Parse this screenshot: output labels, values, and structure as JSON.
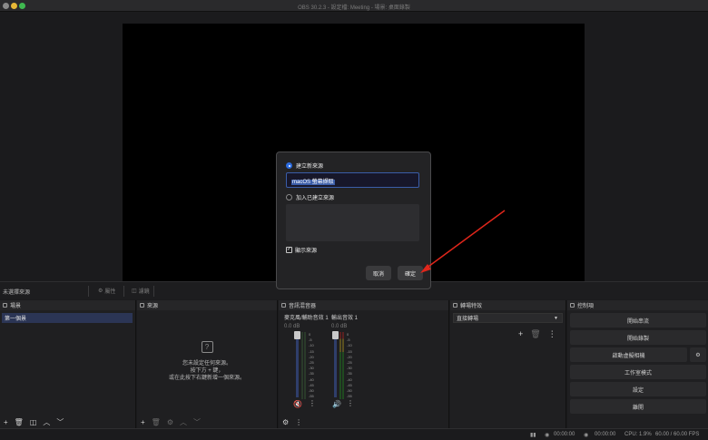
{
  "window": {
    "title": "OBS 30.2.3 - 設定檔: Meeting - 場景: 桌面錄製"
  },
  "source_toolbar": {
    "label": "未選擇來源",
    "properties_label": "屬性",
    "filters_label": "濾鏡"
  },
  "scenes": {
    "header": "場景",
    "items": [
      "第一個景"
    ]
  },
  "sources": {
    "header": "來源",
    "empty_line1": "您未設定任何來源。",
    "empty_line2": "按下方 + 鍵，",
    "empty_line3": "或在此按下右鍵新增一個來源。"
  },
  "mixer": {
    "header": "音訊混音器",
    "channels": [
      {
        "name": "麥克風/輔助音效 1",
        "db": "0.0 dB"
      },
      {
        "name": "輸出音效 1",
        "db": "0.0 dB"
      }
    ],
    "ticks": [
      "0",
      "-5",
      "-10",
      "-15",
      "-20",
      "-25",
      "-30",
      "-35",
      "-40",
      "-45",
      "-50",
      "-55",
      "-60"
    ]
  },
  "transitions": {
    "header": "轉場特效",
    "selected": "直接轉場"
  },
  "controls": {
    "header": "控制項",
    "buttons": [
      "開始串流",
      "開始錄製",
      "啟動虛擬相機",
      "工作室模式",
      "設定",
      "離開"
    ]
  },
  "status": {
    "stream_time": "00:00:00",
    "rec_time": "00:00:00",
    "cpu": "CPU: 1.9%",
    "fps": "60.00 / 60.00 FPS"
  },
  "dialog": {
    "create_new_label": "建立新來源",
    "name_value": "macOS 螢幕擷取",
    "add_existing_label": "加入已建立來源",
    "show_source_label": "顯示來源",
    "cancel_label": "取消",
    "ok_label": "確定"
  },
  "colors": {
    "accent": "#2d6cdf",
    "annotation_arrow": "#e0261b"
  }
}
